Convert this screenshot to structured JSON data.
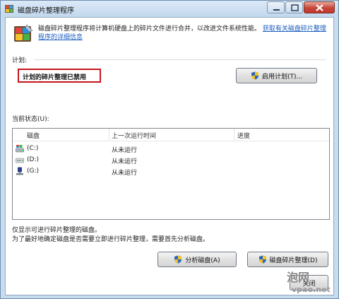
{
  "window": {
    "title": "磁盘碎片整理程序"
  },
  "header": {
    "description": "磁盘碎片整理程序将计算机硬盘上的碎片文件进行合并，以改进文件系统性能。",
    "help_link": "获取有关磁盘碎片整理程序的详细信息"
  },
  "schedule": {
    "label": "计划:",
    "status": "计划的碎片整理已禁用",
    "enable_button": "启用计划(T)..."
  },
  "current_status": {
    "label": "当前状态(U):",
    "columns": [
      "磁盘",
      "上一次运行时间",
      "进度"
    ],
    "rows": [
      {
        "disk": "(C:)",
        "last_run": "从未运行",
        "progress": ""
      },
      {
        "disk": "(D:)",
        "last_run": "从未运行",
        "progress": ""
      },
      {
        "disk": "(G:)",
        "last_run": "从未运行",
        "progress": ""
      }
    ]
  },
  "notes": {
    "line1": "仅显示可进行碎片整理的磁盘。",
    "line2": "为了最好地确定磁盘是否需要立即进行碎片整理，需要首先分析磁盘。"
  },
  "actions": {
    "analyze": "分析磁盘(A)",
    "defragment": "磁盘碎片整理(D)",
    "close": "关闭"
  },
  "watermark": {
    "line1": "泡网",
    "line2": "vpao.net"
  },
  "colors": {
    "highlight_border": "#c4161c",
    "link": "#1b5fbf",
    "window_frame": "#c7dcef"
  },
  "icons": {
    "app": "defrag-icon",
    "shield": "uac-shield-icon",
    "drive_c": "system-drive-icon",
    "drive_d": "optical-drive-icon",
    "drive_g": "usb-drive-icon"
  }
}
